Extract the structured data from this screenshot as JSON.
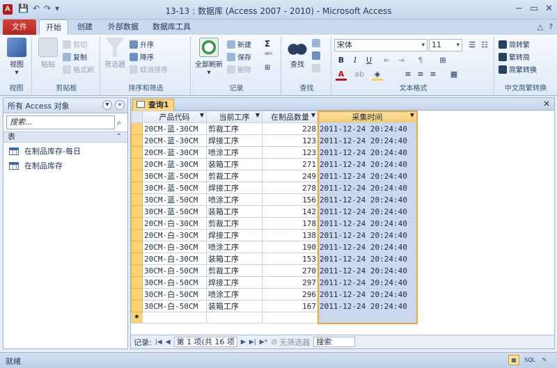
{
  "window": {
    "title": "13-13 : 数据库 (Access 2007 - 2010) - Microsoft Access",
    "app_logo": "A",
    "min": "−",
    "restore": "▭",
    "close": "✕"
  },
  "qat": {
    "save": "💾",
    "undo": "↶",
    "redo": "↷",
    "customize": "▾"
  },
  "ribbon_tabs": {
    "file": "文件",
    "home": "开始",
    "create": "创建",
    "external": "外部数据",
    "dbtools": "数据库工具",
    "help": "?",
    "minimize": "△"
  },
  "ribbon": {
    "views": {
      "view": "视图",
      "label": "视图"
    },
    "clipboard": {
      "paste": "粘贴",
      "cut": "剪切",
      "copy": "复制",
      "format_painter": "格式刷",
      "label": "剪贴板"
    },
    "sort_filter": {
      "filter": "筛选器",
      "asc": "升序",
      "desc": "降序",
      "remove_sort": "取消排序",
      "label": "排序和筛选"
    },
    "records": {
      "refresh_all": "全部刷新",
      "new": "新建",
      "save": "保存",
      "delete": "删除",
      "totals": "Σ",
      "spelling": "ᵃᵇᶜ",
      "more": "⊞",
      "label": "记录"
    },
    "find": {
      "find": "查找",
      "label": "查找"
    },
    "text_format": {
      "font": "宋体",
      "size": "11",
      "bold": "B",
      "italic": "I",
      "underline": "U",
      "label": "文本格式"
    },
    "chinese": {
      "to_trad": "简转繁",
      "to_simp": "繁转简",
      "convert": "简繁转换",
      "label": "中文简繁转换"
    }
  },
  "nav": {
    "title": "所有 Access 对象",
    "search_placeholder": "搜索...",
    "group": "表",
    "items": [
      "在制品库存-每日",
      "在制品库存"
    ]
  },
  "doc": {
    "tab": "查询1",
    "close": "✕",
    "columns": [
      "产品代码",
      "当前工序",
      "在制品数量",
      "采集时间"
    ],
    "rows": [
      [
        "20CM-蓝-30CM",
        "剪裁工序",
        "228",
        "2011-12-24 20:24:40"
      ],
      [
        "20CM-蓝-30CM",
        "焊接工序",
        "123",
        "2011-12-24 20:24:40"
      ],
      [
        "20CM-蓝-30CM",
        "喷涂工序",
        "123",
        "2011-12-24 20:24:40"
      ],
      [
        "20CM-蓝-30CM",
        "装箱工序",
        "271",
        "2011-12-24 20:24:40"
      ],
      [
        "30CM-蓝-50CM",
        "剪裁工序",
        "249",
        "2011-12-24 20:24:40"
      ],
      [
        "30CM-蓝-50CM",
        "焊接工序",
        "278",
        "2011-12-24 20:24:40"
      ],
      [
        "30CM-蓝-50CM",
        "喷涂工序",
        "156",
        "2011-12-24 20:24:40"
      ],
      [
        "30CM-蓝-50CM",
        "装箱工序",
        "142",
        "2011-12-24 20:24:40"
      ],
      [
        "20CM-白-30CM",
        "剪裁工序",
        "178",
        "2011-12-24 20:24:40"
      ],
      [
        "20CM-白-30CM",
        "焊接工序",
        "138",
        "2011-12-24 20:24:40"
      ],
      [
        "20CM-白-30CM",
        "喷涂工序",
        "190",
        "2011-12-24 20:24:40"
      ],
      [
        "20CM-白-30CM",
        "装箱工序",
        "153",
        "2011-12-24 20:24:40"
      ],
      [
        "30CM-白-50CM",
        "剪裁工序",
        "270",
        "2011-12-24 20:24:40"
      ],
      [
        "30CM-白-50CM",
        "焊接工序",
        "297",
        "2011-12-24 20:24:40"
      ],
      [
        "30CM-白-50CM",
        "喷涂工序",
        "296",
        "2011-12-24 20:24:40"
      ],
      [
        "30CM-白-50CM",
        "装箱工序",
        "167",
        "2011-12-24 20:24:40"
      ]
    ],
    "new_row_marker": "*"
  },
  "record_nav": {
    "label": "记录:",
    "first": "|◀",
    "prev": "◀",
    "current": "第 1 项(共 16 项",
    "next": "▶",
    "last": "▶|",
    "new": "▶*",
    "filter": "无筛选器",
    "search": "搜索"
  },
  "status": {
    "text": "就绪",
    "view_datasheet": "▦",
    "view_sql": "SQL",
    "view_design": "✎"
  },
  "colors": {
    "accent": "#f0a33a",
    "file_tab": "#c0332b",
    "selected_col": "#cad9ee"
  }
}
